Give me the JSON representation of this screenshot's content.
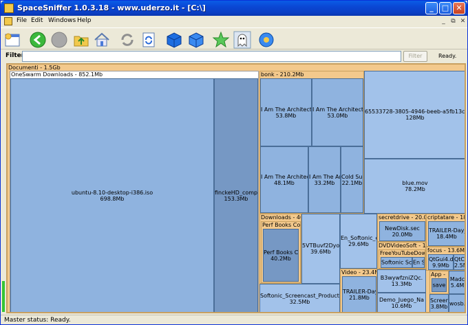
{
  "window": {
    "title": "SpaceSniffer 1.0.3.18 - www.uderzo.it - [C:\\]",
    "minimize": "_",
    "maximize": "□",
    "close": "✕"
  },
  "menu": {
    "items": [
      "File",
      "Edit",
      "Windows",
      "Help"
    ],
    "mdi": [
      "_",
      "⧉",
      "✕"
    ]
  },
  "toolbar": {
    "icons": [
      "new-scan-icon",
      "back-icon",
      "stop-icon",
      "folder-up-icon",
      "home-icon",
      "refresh-icon",
      "rescan-icon",
      "cube-icon",
      "cube-alt-icon",
      "star-icon",
      "ghost-icon",
      "settings-icon"
    ]
  },
  "filter": {
    "label": "Filter",
    "value": "",
    "button": "Filter",
    "status": "Ready."
  },
  "map": {
    "root": "Documenti - 1.5Gb",
    "oneswarm": "OneSwarm Downloads - 852.1Mb",
    "ubuntu": {
      "name": "ubuntu-8.10-desktop-i386.iso",
      "size": "698.8Mb"
    },
    "fincke": {
      "name": "finckeHD_compress",
      "size": "153.3Mb"
    },
    "bonk": "bonk - 210.2Mb",
    "arch1": {
      "name": "I Am The Architect - S",
      "size": "53.8Mb"
    },
    "arch2": {
      "name": "I Am The Architect - I",
      "size": "53.0Mb"
    },
    "arch3": {
      "name": "I Am The Architect - ",
      "size": "48.1Mb"
    },
    "arch4": {
      "name": "I Am The Arc",
      "size": "33.2Mb"
    },
    "coldsun": {
      "name": "Cold Sun",
      "size": "22.1Mb"
    },
    "guid": {
      "name": "65533728-3805-4946-beeb-a5fb13cfa89c.Spee",
      "size": "128Mb"
    },
    "bluemov": {
      "name": "blue.mov",
      "size": "78.2Mb"
    },
    "downloads": "Downloads - 40.2",
    "perfbooks": "Perf Books Colle",
    "perfbooksfile": {
      "name": "Perf Books Coll",
      "size": "40.2Mb"
    },
    "svt": {
      "name": "5VTBuvf2DyoC.",
      "size": "39.6Mb"
    },
    "ensoft": {
      "name": "En_Softonic_cor",
      "size": "29.6Mb"
    },
    "screencast": {
      "name": "Softonic_Screencast_Production.avi",
      "size": "32.5Mb"
    },
    "video": "Video - 23.4Mb",
    "trailer1": {
      "name": "TRAILER-Day_",
      "size": "21.8Mb"
    },
    "secretdrive": "secretdrive - 20.0Mb",
    "newdisk": {
      "name": "NewDisk.sec",
      "size": "20.0Mb"
    },
    "criptatare": "criptatare - 18.4M",
    "trailer2": {
      "name": "TRAILER-Day_",
      "size": "18.4Mb"
    },
    "dvdvideosoft": "DVDVideoSoft - 19.7",
    "freeyoutube": "FreeYouTubeDownlo",
    "softonicscre": "Softonic Scre",
    "ensoft2": "En So",
    "focus": "focus - 13.6Mb",
    "qtgui": {
      "name": "QtGui4.dll",
      "size": "9.9Mb"
    },
    "qtc": {
      "name": "QtC",
      "size": "2.5M"
    },
    "b3wy": {
      "name": "B3wywfzniZQc.",
      "size": "13.3Mb"
    },
    "demo": {
      "name": "Demo_Juego_Na",
      "size": "10.6Mb"
    },
    "app": "App -",
    "save": "save",
    "madc": {
      "name": "Madc",
      "size": "5.4M"
    },
    "screen": {
      "name": "Screen",
      "size": "3.8Mb"
    },
    "wosb": "wosb."
  },
  "statusbar": {
    "text": "Master status: Ready."
  }
}
